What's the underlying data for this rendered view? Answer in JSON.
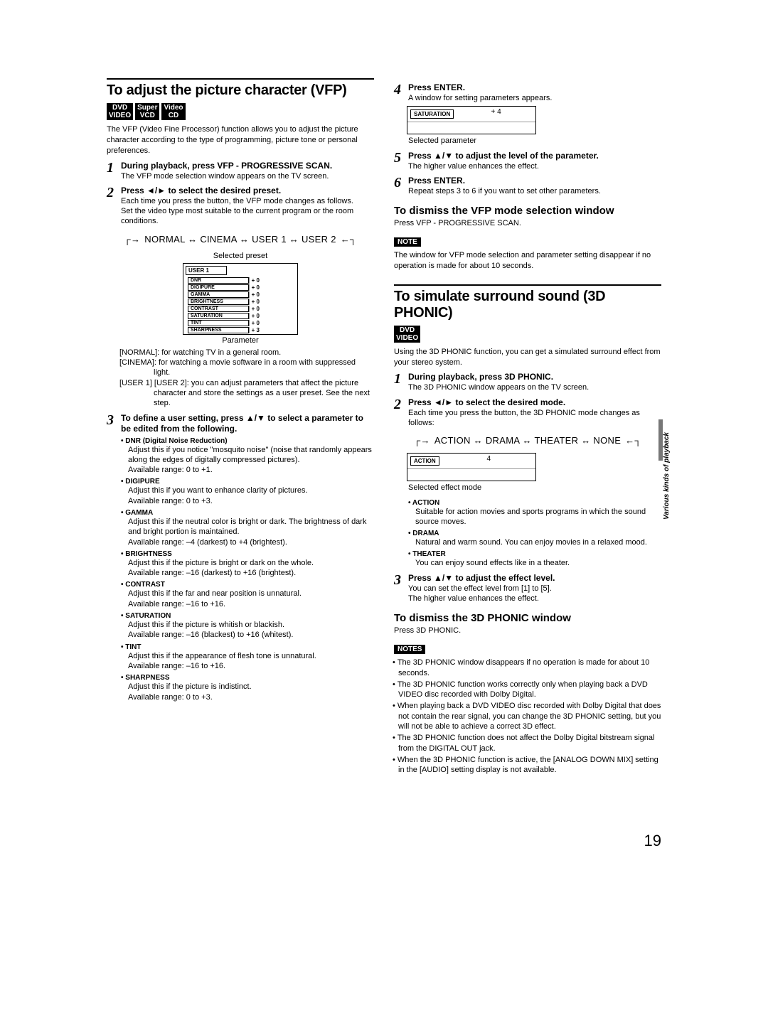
{
  "page_number": "19",
  "side_tab": "Various kinds of playback",
  "left": {
    "section_title": "To adjust the picture character (VFP)",
    "badges": [
      "DVD\nVIDEO",
      "Super\nVCD",
      "Video\nCD"
    ],
    "intro": "The VFP (Video Fine Processor) function allows you to adjust the picture character according to the type of programming, picture tone or personal preferences.",
    "step1_head": "During playback, press VFP - PROGRESSIVE SCAN.",
    "step1_body": "The VFP mode selection window appears on the TV screen.",
    "step2_head": "Press ◄/► to select the desired preset.",
    "step2_body1": "Each time you press the button, the VFP mode changes as follows.",
    "step2_body2": "Set the video type most suitable to the current program or the room conditions.",
    "cycle1": "NORMAL ↔ CINEMA ↔ USER 1 ↔ USER 2",
    "caption1": "Selected preset",
    "caption2": "Parameter",
    "table": {
      "header": "USER 1",
      "rows": [
        [
          "DNR",
          "+ 0"
        ],
        [
          "DIGIPURE",
          "+ 0"
        ],
        [
          "GAMMA",
          "+ 0"
        ],
        [
          "BRIGHTNESS",
          "+ 0"
        ],
        [
          "CONTRAST",
          "+ 0"
        ],
        [
          "SATURATION",
          "+ 0"
        ],
        [
          "TINT",
          "+ 0"
        ],
        [
          "SHARPNESS",
          "+ 3"
        ]
      ]
    },
    "desc_normal": "[NORMAL]: for watching TV in a general room.",
    "desc_cinema": "[CINEMA]: for watching a movie software in a room with suppressed light.",
    "desc_user": "[USER 1] [USER 2]: you can adjust parameters that affect the picture character and store the settings as a user preset. See the next step.",
    "step3_head": "To define a user setting, press ▲/▼ to select a parameter to be edited from the following.",
    "params": [
      {
        "t": "DNR (Digital Noise Reduction)",
        "b": "Adjust this if you notice \"mosquito noise\" (noise that randomly appears along the edges of digitally compressed pictures).\nAvailable range: 0 to +1."
      },
      {
        "t": "DIGIPURE",
        "b": "Adjust this if you want to enhance clarity of pictures.\nAvailable range: 0 to +3."
      },
      {
        "t": "GAMMA",
        "b": "Adjust this if the neutral color is bright or dark. The brightness of dark and bright portion is maintained.\nAvailable range: –4 (darkest) to +4 (brightest)."
      },
      {
        "t": "BRIGHTNESS",
        "b": "Adjust this if the picture is bright or dark on the whole.\nAvailable range: –16 (darkest) to +16 (brightest)."
      },
      {
        "t": "CONTRAST",
        "b": "Adjust this if the far and near position is unnatural.\nAvailable range: –16 to +16."
      },
      {
        "t": "SATURATION",
        "b": "Adjust this if the picture is whitish or blackish.\nAvailable range: –16 (blackest) to +16 (whitest)."
      },
      {
        "t": "TINT",
        "b": "Adjust this if the appearance of flesh tone is unnatural.\nAvailable range: –16 to +16."
      },
      {
        "t": "SHARPNESS",
        "b": "Adjust this if the picture is indistinct.\nAvailable range: 0 to +3."
      }
    ]
  },
  "right": {
    "step4_head": "Press ENTER.",
    "step4_body": "A window for setting parameters appears.",
    "osd1_label": "SATURATION",
    "osd1_value": "+ 4",
    "osd1_cap": "Selected parameter",
    "step5_head": "Press ▲/▼ to adjust the level of the parameter.",
    "step5_body": "The higher value enhances the effect.",
    "step6_head": "Press ENTER.",
    "step6_body": "Repeat steps 3 to 6 if you want to set other parameters.",
    "dismiss1_head": "To dismiss the VFP mode selection window",
    "dismiss1_body": "Press VFP - PROGRESSIVE SCAN.",
    "note_tag": "NOTE",
    "note_body": "The window for VFP mode selection and parameter setting disappear if no operation is made for about 10 seconds.",
    "section2_title": "To simulate surround sound (3D PHONIC)",
    "badge2": "DVD\nVIDEO",
    "intro2": "Using the 3D PHONIC function, you can get a simulated surround effect from your stereo system.",
    "s1_head": "During playback, press 3D PHONIC.",
    "s1_body": "The 3D PHONIC window appears on the TV screen.",
    "s2_head": "Press ◄/► to select the desired mode.",
    "s2_body": "Each time you press the button, the 3D PHONIC mode changes as follows:",
    "cycle2": "ACTION ↔ DRAMA ↔ THEATER ↔ NONE",
    "osd2_label": "ACTION",
    "osd2_value": "4",
    "osd2_cap": "Selected effect mode",
    "modes": [
      {
        "t": "ACTION",
        "b": "Suitable for action movies and sports programs in which the sound source moves."
      },
      {
        "t": "DRAMA",
        "b": "Natural and warm sound. You can enjoy movies in a relaxed mood."
      },
      {
        "t": "THEATER",
        "b": "You can enjoy sound effects like in a theater."
      }
    ],
    "s3_head": "Press ▲/▼ to adjust the effect level.",
    "s3_body": "You can set the effect level from [1] to [5].\nThe higher value enhances the effect.",
    "dismiss2_head": "To dismiss the 3D PHONIC window",
    "dismiss2_body": "Press 3D PHONIC.",
    "notes_tag": "NOTES",
    "notes": [
      "The 3D PHONIC window disappears if no operation is made for about 10 seconds.",
      "The 3D PHONIC function works correctly only when playing back a DVD VIDEO disc recorded with Dolby Digital.",
      "When playing back a DVD VIDEO disc recorded with Dolby Digital that does not contain the rear signal, you can change the 3D PHONIC setting, but you will not be able to achieve a correct 3D effect.",
      "The 3D PHONIC function does not affect the Dolby Digital bitstream signal from the DIGITAL OUT jack.",
      "When the 3D PHONIC function is active, the [ANALOG DOWN MIX] setting in the [AUDIO] setting display is not available."
    ]
  }
}
